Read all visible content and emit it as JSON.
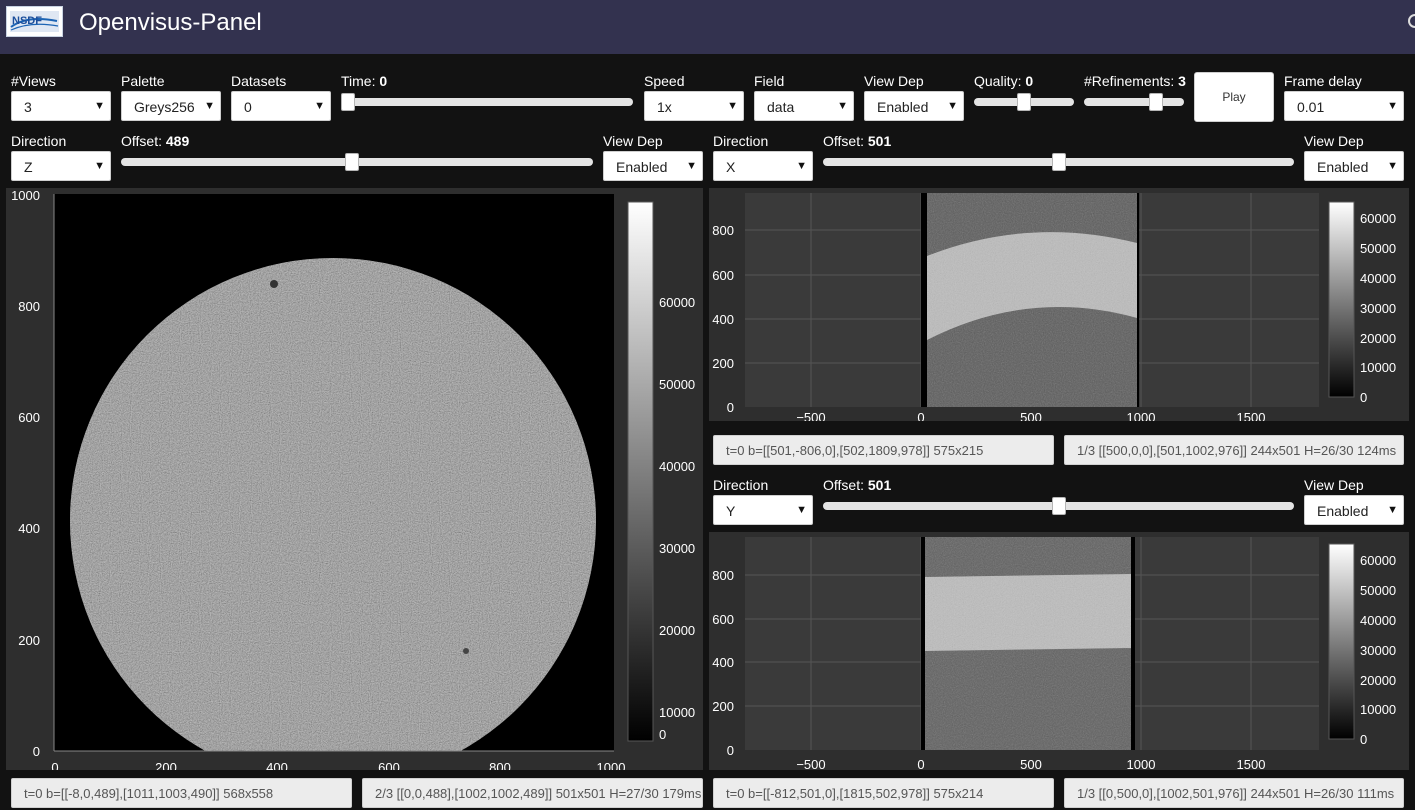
{
  "app": {
    "title": "Openvisus-Panel",
    "logo_text": "NSDF"
  },
  "controls": {
    "views": {
      "label": "#Views",
      "value": "3"
    },
    "palette": {
      "label": "Palette",
      "value": "Greys256"
    },
    "datasets": {
      "label": "Datasets",
      "value": "0"
    },
    "time": {
      "label": "Time:",
      "value": "0",
      "level": 0
    },
    "speed": {
      "label": "Speed",
      "value": "1x"
    },
    "field": {
      "label": "Field",
      "value": "data"
    },
    "view_dep": {
      "label": "View Dep",
      "value": "Enabled"
    },
    "quality": {
      "label": "Quality:",
      "value": "0",
      "level": 0.5
    },
    "refinements": {
      "label": "#Refinements:",
      "value": "3",
      "level": 0.75
    },
    "play": {
      "label": "Play"
    },
    "frame_delay": {
      "label": "Frame delay",
      "value": "0.01"
    }
  },
  "view1": {
    "direction": {
      "label": "Direction",
      "value": "Z"
    },
    "offset": {
      "label": "Offset:",
      "value": "489",
      "level": 0.489
    },
    "view_dep": {
      "label": "View Dep",
      "value": "Enabled"
    },
    "status_left": "t=0 b=[[-8,0,489],[1011,1003,490]] 568x558",
    "status_right": "2/3 [[0,0,488],[1002,1002,489]] 501x501 H=27/30 179ms",
    "axes": {
      "x_ticks": [
        "0",
        "200",
        "400",
        "600",
        "800",
        "1000"
      ],
      "y_ticks": [
        "0",
        "200",
        "400",
        "600",
        "800",
        "1000"
      ]
    },
    "colorbar_ticks": [
      "0",
      "10000",
      "20000",
      "30000",
      "40000",
      "50000",
      "60000"
    ]
  },
  "view2": {
    "direction": {
      "label": "Direction",
      "value": "X"
    },
    "offset": {
      "label": "Offset:",
      "value": "501",
      "level": 0.501
    },
    "view_dep": {
      "label": "View Dep",
      "value": "Enabled"
    },
    "status_left": "t=0 b=[[501,-806,0],[502,1809,978]] 575x215",
    "status_right": "1/3 [[500,0,0],[501,1002,976]] 244x501 H=26/30 124ms",
    "axes": {
      "x_ticks": [
        "−500",
        "0",
        "500",
        "1000",
        "1500"
      ],
      "y_ticks": [
        "0",
        "200",
        "400",
        "600",
        "800"
      ]
    },
    "colorbar_ticks": [
      "0",
      "10000",
      "20000",
      "30000",
      "40000",
      "50000",
      "60000"
    ]
  },
  "view3": {
    "direction": {
      "label": "Direction",
      "value": "Y"
    },
    "offset": {
      "label": "Offset:",
      "value": "501",
      "level": 0.501
    },
    "view_dep": {
      "label": "View Dep",
      "value": "Enabled"
    },
    "status_left": "t=0 b=[[-812,501,0],[1815,502,978]] 575x214",
    "status_right": "1/3 [[0,500,0],[1002,501,976]] 244x501 H=26/30 111ms",
    "axes": {
      "x_ticks": [
        "−500",
        "0",
        "500",
        "1000",
        "1500"
      ],
      "y_ticks": [
        "0",
        "200",
        "400",
        "600",
        "800"
      ]
    },
    "colorbar_ticks": [
      "0",
      "10000",
      "20000",
      "30000",
      "40000",
      "50000",
      "60000"
    ]
  },
  "colors": {
    "header_bg": "#33324f",
    "page_bg": "#121212",
    "panel_bg": "#2e2e2e"
  }
}
